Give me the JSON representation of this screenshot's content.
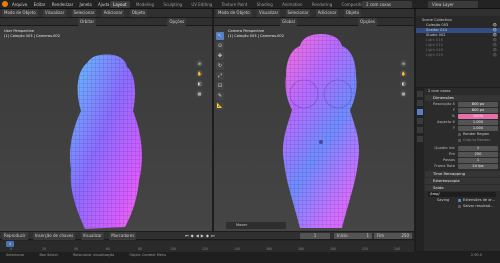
{
  "menu": {
    "items": [
      "Arquivo",
      "Editar",
      "Renderizar",
      "Janela",
      "Ajuda"
    ]
  },
  "workspaces": {
    "tabs": [
      "Layout",
      "Modeling",
      "Sculpting",
      "UV Editing",
      "Texture Paint",
      "Shading",
      "Animation",
      "Rendering",
      "Compositing",
      "Script"
    ],
    "active": "Layout"
  },
  "scene": {
    "name": "2 com coxas"
  },
  "view_layer": {
    "name": "View Layer"
  },
  "left_viewport": {
    "header_buttons": [
      "Modo de Objeto",
      "Visualizar",
      "Selecionar",
      "Adicionar",
      "Objeto"
    ],
    "mode_button": "Orbitar",
    "options_label": "Opções",
    "overlay_line1": "User Perspective",
    "overlay_line2": "(1) Coleção 003 | Cameras.002"
  },
  "right_viewport": {
    "header_buttons": [
      "Modo de Objeto",
      "Visualizar",
      "Selecionar",
      "Adicionar",
      "Objeto"
    ],
    "mode_button": "Global",
    "options_label": "Opções",
    "overlay_line1": "Camera Perspective",
    "overlay_line2": "(1) Coleção 003 | Cameras.002",
    "mover_panel": "Mover"
  },
  "outliner": {
    "title": "Scene Collection",
    "rows": [
      {
        "name": "Coleção 003",
        "selected": false
      },
      {
        "name": "Scatter 014",
        "selected": true
      },
      {
        "name": "Studio 002",
        "selected": false
      },
      {
        "name": "Light 016",
        "selected": false
      },
      {
        "name": "Light 015",
        "selected": false
      },
      {
        "name": "Light 018",
        "selected": false
      },
      {
        "name": "Light 019",
        "selected": false
      }
    ]
  },
  "properties": {
    "scene_label": "2 com coxas",
    "dimensions_title": "Dimensões",
    "rows": [
      {
        "label": "Resolução X",
        "value": "800 px",
        "highlight": false
      },
      {
        "label": "Y",
        "value": "800 px",
        "highlight": false
      },
      {
        "label": "%",
        "value": "100%",
        "highlight": true
      },
      {
        "label": "Aspecto X",
        "value": "1.000",
        "highlight": false
      },
      {
        "label": "Y",
        "value": "1.000",
        "highlight": false
      }
    ],
    "render_region": "Render Region",
    "crop_region": "Crop to Render",
    "frame_rows": [
      {
        "label": "Quadro inic",
        "value": "1"
      },
      {
        "label": "Fim",
        "value": "250"
      },
      {
        "label": "Passos",
        "value": "1"
      },
      {
        "label": "Frame Rate",
        "value": "24 fps"
      }
    ],
    "sections": [
      "Time Remapping",
      "Estereoscopia",
      "Saída"
    ],
    "output_path": "/tmp/",
    "saving_label": "Saving",
    "file_ext_label": "Extensões de ar...",
    "cache_label": "Salvar resultad..."
  },
  "timeline": {
    "controls": [
      "Reproduzir",
      "Inserção de chaves",
      "Visualizar",
      "Marcadores"
    ],
    "current_frame": "1",
    "start_label": "Início",
    "start_value": "1",
    "end_label": "Fim",
    "end_value": "250",
    "ticks": [
      "0",
      "20",
      "40",
      "60",
      "80",
      "100",
      "120",
      "140",
      "160",
      "180",
      "200",
      "220",
      "240"
    ]
  },
  "status_bar": {
    "items": [
      "Selecionar",
      "Box Select",
      "Rotacionar visualização",
      "Object Context Menu"
    ],
    "version": "2.90.0"
  }
}
